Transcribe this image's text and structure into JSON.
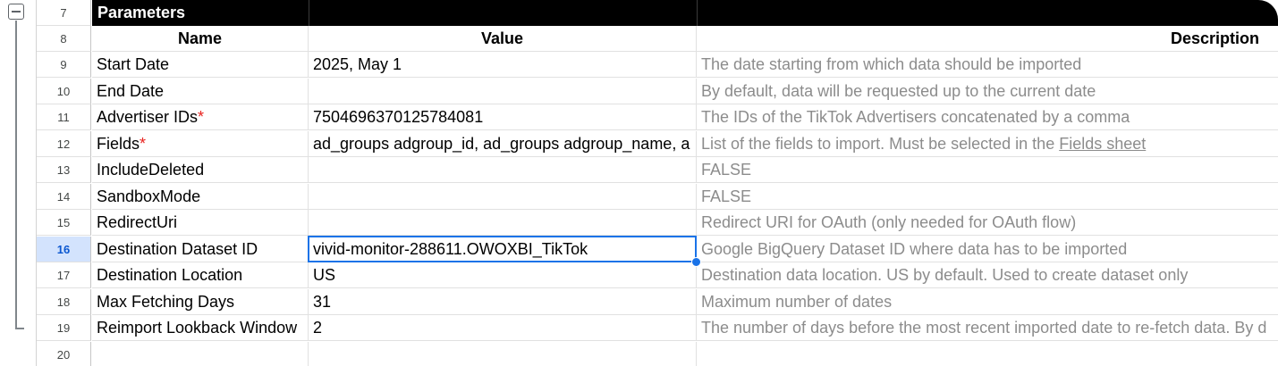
{
  "rows": {
    "r7": "7",
    "r8": "8",
    "r9": "9",
    "r10": "10",
    "r11": "11",
    "r12": "12",
    "r13": "13",
    "r14": "14",
    "r15": "15",
    "r16": "16",
    "r17": "17",
    "r18": "18",
    "r19": "19",
    "r20": "20"
  },
  "section_title": "Parameters",
  "headers": {
    "name": "Name",
    "value": "Value",
    "description": "Description"
  },
  "required_mark": "*",
  "params": [
    {
      "name": "Start Date",
      "value": "2025, May 1",
      "description": "The date starting from which data should be imported"
    },
    {
      "name": "End Date",
      "value": "",
      "description": "By default, data will be requested up to the current date"
    },
    {
      "name": "Advertiser IDs",
      "value": "7504696370125784081",
      "description": "The IDs of the TikTok Advertisers concatenated by a comma"
    },
    {
      "name": "Fields",
      "value": "ad_groups adgroup_id, ad_groups adgroup_name, a",
      "description": "List of the fields to import. Must be selected in the",
      "link": "Fields sheet"
    },
    {
      "name": "IncludeDeleted",
      "value": "",
      "description": "FALSE"
    },
    {
      "name": "SandboxMode",
      "value": "",
      "description": "FALSE"
    },
    {
      "name": "RedirectUri",
      "value": "",
      "description": "Redirect URI for OAuth (only needed for OAuth flow)"
    },
    {
      "name": "Destination Dataset ID",
      "value": "vivid-monitor-288611.OWOXBI_TikTok",
      "description": "Google BigQuery Dataset ID where data has to be imported"
    },
    {
      "name": "Destination Location",
      "value": "US",
      "description": "Destination data location. US by default. Used to create dataset only"
    },
    {
      "name": "Max Fetching Days",
      "value": "31",
      "description": "Maximum number of dates"
    },
    {
      "name": "Reimport Lookback Window",
      "value": "2",
      "description": "The number of days before the most recent imported date to re-fetch data. By d"
    }
  ],
  "colors": {
    "selection": "#1a73e8",
    "required": "#e8231f",
    "description_text": "#8c8c8c"
  },
  "icons": {
    "outline_toggle": "collapse-minus-icon"
  }
}
